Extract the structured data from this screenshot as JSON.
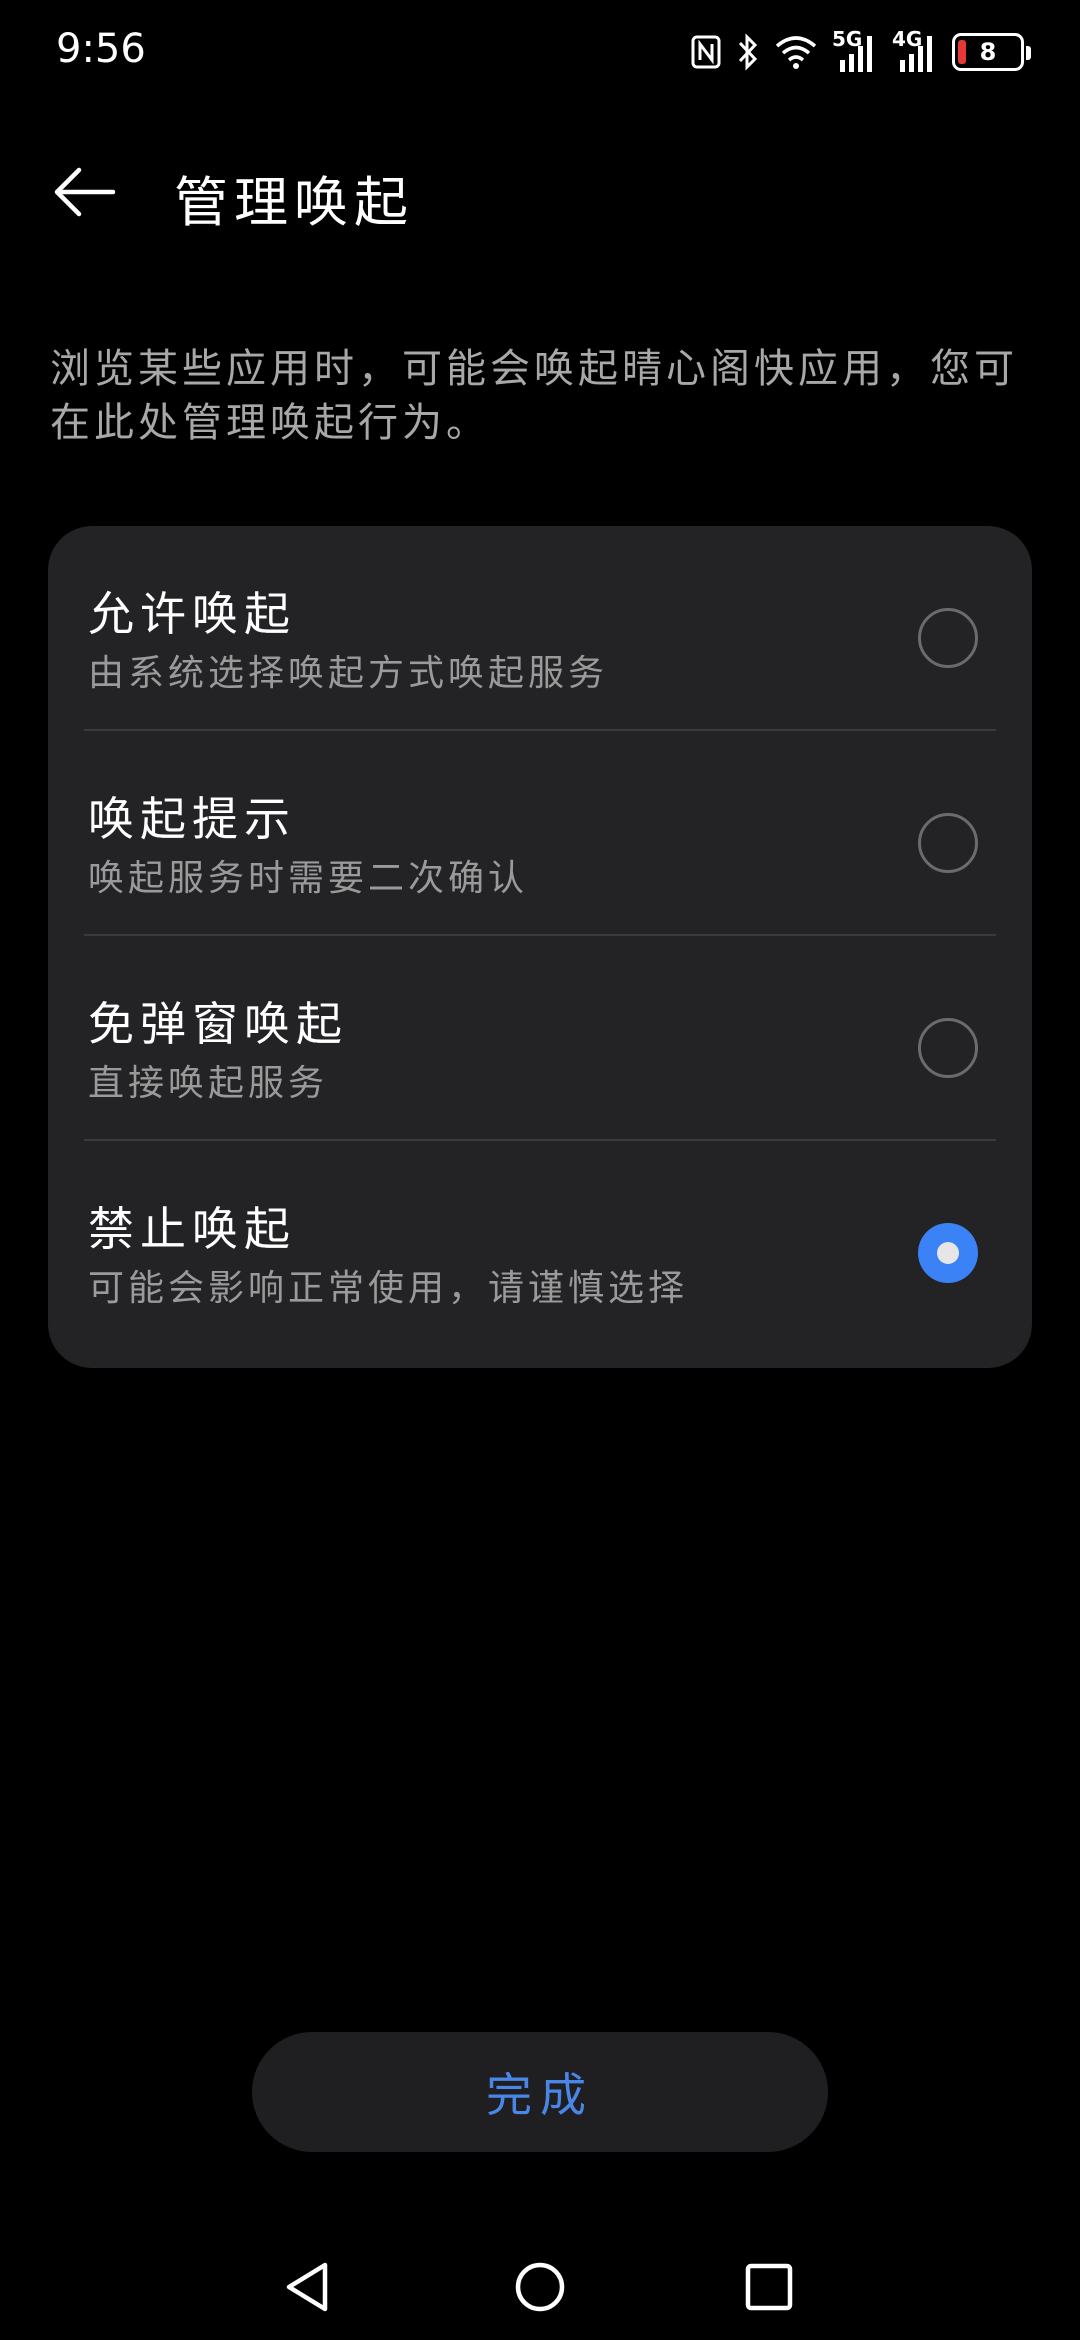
{
  "status_bar": {
    "time": "9:56",
    "net1": "5G",
    "net2": "4G",
    "battery": "8",
    "battery_color": "#e53935"
  },
  "header": {
    "title": "管理唤起",
    "back_icon": "arrow-left-icon"
  },
  "description": "浏览某些应用时，可能会唤起晴心阁快应用，您可在此处管理唤起行为。",
  "options": [
    {
      "title": "允许唤起",
      "subtitle": "由系统选择唤起方式唤起服务",
      "selected": false
    },
    {
      "title": "唤起提示",
      "subtitle": "唤起服务时需要二次确认",
      "selected": false
    },
    {
      "title": "免弹窗唤起",
      "subtitle": "直接唤起服务",
      "selected": false
    },
    {
      "title": "禁止唤起",
      "subtitle": "可能会影响正常使用，请谨慎选择",
      "selected": true
    }
  ],
  "done_button": {
    "label": "完成",
    "color": "#4a86e8"
  },
  "accent_color": "#3b82f6",
  "nav_bar": {
    "icons": [
      "nav-back-icon",
      "nav-home-icon",
      "nav-recents-icon"
    ]
  }
}
